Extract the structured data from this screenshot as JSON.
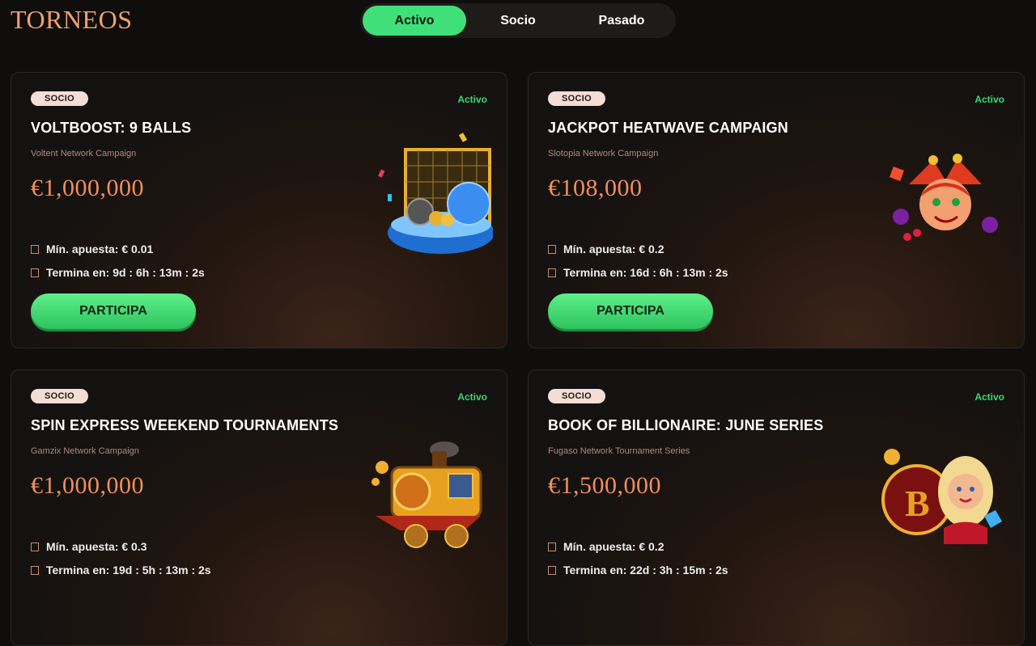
{
  "header": {
    "logo": "TORNEOS"
  },
  "tabs": [
    {
      "label": "Activo",
      "active": true
    },
    {
      "label": "Socio",
      "active": false
    },
    {
      "label": "Pasado",
      "active": false
    }
  ],
  "cards": [
    {
      "badge": "SOCIO",
      "status": "Activo",
      "title": "VOLTBOOST: 9 BALLS",
      "subtitle": "Voltent Network Campaign",
      "prize": "€1,000,000",
      "min_bet": "Mín. apuesta: € 0.01",
      "ends": "Termina en: 9d : 6h : 13m : 2s",
      "button": "PARTICIPA",
      "art": "soccer-goal-art"
    },
    {
      "badge": "SOCIO",
      "status": "Activo",
      "title": "JACKPOT HEATWAVE CAMPAIGN",
      "subtitle": "Slotopia Network Campaign",
      "prize": "€108,000",
      "min_bet": "Mín. apuesta: € 0.2",
      "ends": "Termina en: 16d : 6h : 13m : 2s",
      "button": "PARTICIPA",
      "art": "jester-art"
    },
    {
      "badge": "SOCIO",
      "status": "Activo",
      "title": "SPIN EXPRESS WEEKEND TOURNAMENTS",
      "subtitle": "Gamzix Network Campaign",
      "prize": "€1,000,000",
      "min_bet": "Mín. apuesta: € 0.3",
      "ends": "Termina en: 19d : 5h : 13m : 2s",
      "art": "train-art"
    },
    {
      "badge": "SOCIO",
      "status": "Activo",
      "title": "BOOK OF BILLIONAIRE: JUNE SERIES",
      "subtitle": "Fugaso Network Tournament Series",
      "prize": "€1,500,000",
      "min_bet": "Mín. apuesta: € 0.2",
      "ends": "Termina en: 22d : 3h : 15m : 2s",
      "art": "billionaire-art"
    }
  ],
  "colors": {
    "accent_green": "#3fe07a",
    "prize_orange": "#f08e5e",
    "logo": "#f0a070"
  }
}
